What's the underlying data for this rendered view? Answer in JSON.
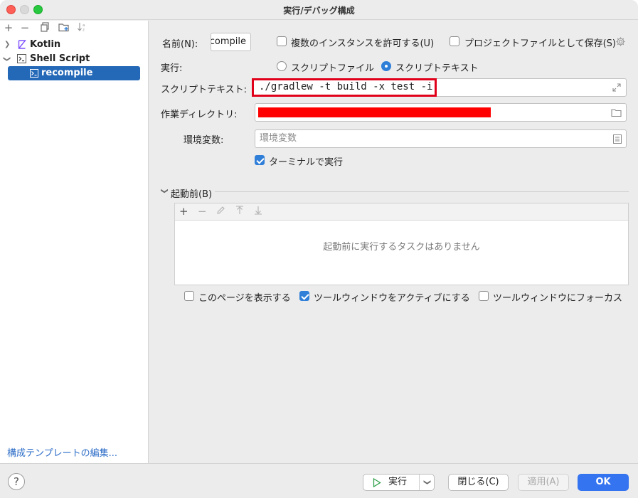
{
  "window": {
    "title": "実行/デバッグ構成"
  },
  "toolbar": {
    "icons": [
      "add-icon",
      "remove-icon",
      "copy-icon",
      "new-folder-icon",
      "sort-icon"
    ]
  },
  "tree": {
    "items": [
      {
        "label": "Kotlin",
        "icon": "kotlin-icon",
        "expanded": false
      },
      {
        "label": "Shell Script",
        "icon": "shell-script-icon",
        "expanded": true
      },
      {
        "label": "recompile",
        "icon": "terminal-icon",
        "selected": true
      }
    ],
    "edit_templates_link": "構成テンプレートの編集..."
  },
  "form": {
    "name_label": "名前(N):",
    "name_value": "compile",
    "allow_multiple_label": "複数のインスタンスを許可する(U)",
    "allow_multiple_checked": false,
    "save_as_project_label": "プロジェクトファイルとして保存(S)",
    "save_as_project_checked": false,
    "execute_label": "実行:",
    "radio_script_file": "スクリプトファイル",
    "radio_script_text": "スクリプトテキスト",
    "selected_radio": "スクリプトテキスト",
    "script_text_label": "スクリプトテキスト:",
    "script_text_value": "./gradlew -t build -x test -i",
    "working_dir_label": "作業ディレクトリ:",
    "working_dir_value": "",
    "env_label": "環境変数:",
    "env_placeholder": "環境変数",
    "run_in_terminal_label": "ターミナルで実行",
    "run_in_terminal_checked": true
  },
  "before_launch": {
    "section_title": "起動前(B)",
    "empty_text": "起動前に実行するタスクはありません",
    "show_page_label": "このページを表示する",
    "show_page_checked": false,
    "activate_tool_window_label": "ツールウィンドウをアクティブにする",
    "activate_tool_window_checked": true,
    "focus_tool_window_label": "ツールウィンドウにフォーカス",
    "focus_tool_window_checked": false
  },
  "buttons": {
    "run": "実行",
    "close": "閉じる(C)",
    "apply": "適用(A)",
    "ok": "OK",
    "help": "?"
  },
  "colors": {
    "accent": "#3574f0",
    "selection": "#2468b8",
    "highlight_border": "#e0001a",
    "redaction": "#ff0000"
  }
}
